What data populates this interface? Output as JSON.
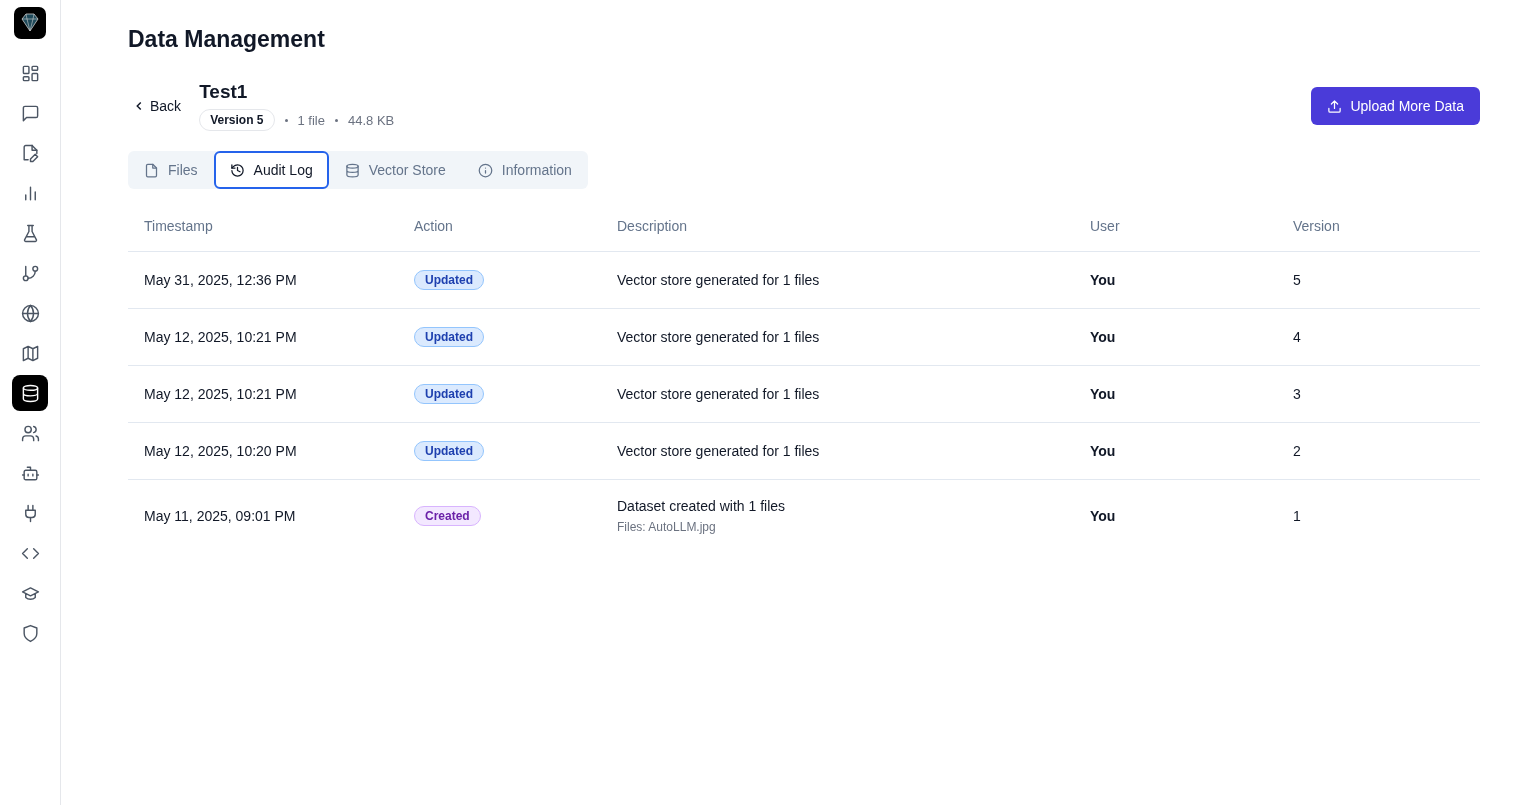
{
  "sidebar": {
    "items": [
      {
        "kind": "grid",
        "selected": false
      },
      {
        "kind": "chat",
        "selected": false
      },
      {
        "kind": "file-edit",
        "selected": false
      },
      {
        "kind": "bars",
        "selected": false
      },
      {
        "kind": "flask",
        "selected": false
      },
      {
        "kind": "branch",
        "selected": false
      },
      {
        "kind": "globe",
        "selected": false
      },
      {
        "kind": "map",
        "selected": false
      },
      {
        "kind": "database",
        "selected": true
      },
      {
        "kind": "users",
        "selected": false
      },
      {
        "kind": "bot",
        "selected": false
      },
      {
        "kind": "plug",
        "selected": false
      },
      {
        "kind": "code",
        "selected": false
      },
      {
        "kind": "cap",
        "selected": false
      },
      {
        "kind": "shield",
        "selected": false
      }
    ]
  },
  "page": {
    "title": "Data Management"
  },
  "dataset": {
    "back": "Back",
    "name": "Test1",
    "version": "Version 5",
    "files": "1 file",
    "size": "44.8 KB",
    "upload_button": "Upload More Data"
  },
  "tabs": [
    {
      "label": "Files",
      "kind": "file",
      "selected": false
    },
    {
      "label": "Audit Log",
      "kind": "history",
      "selected": true
    },
    {
      "label": "Vector Store",
      "kind": "database",
      "selected": false
    },
    {
      "label": "Information",
      "kind": "info",
      "selected": false
    }
  ],
  "table": {
    "columns": [
      "Timestamp",
      "Action",
      "Description",
      "User",
      "Version"
    ],
    "rows": [
      {
        "timestamp": "May 31, 2025, 12:36 PM",
        "action": {
          "label": "Updated",
          "kind": "updated"
        },
        "description": "Vector store generated for 1 files",
        "user": "You",
        "version": "5"
      },
      {
        "timestamp": "May 12, 2025, 10:21 PM",
        "action": {
          "label": "Updated",
          "kind": "updated"
        },
        "description": "Vector store generated for 1 files",
        "user": "You",
        "version": "4"
      },
      {
        "timestamp": "May 12, 2025, 10:21 PM",
        "action": {
          "label": "Updated",
          "kind": "updated"
        },
        "description": "Vector store generated for 1 files",
        "user": "You",
        "version": "3"
      },
      {
        "timestamp": "May 12, 2025, 10:20 PM",
        "action": {
          "label": "Updated",
          "kind": "updated"
        },
        "description": "Vector store generated for 1 files",
        "user": "You",
        "version": "2"
      },
      {
        "timestamp": "May 11, 2025, 09:01 PM",
        "action": {
          "label": "Created",
          "kind": "created"
        },
        "description": "Dataset created with 1 files",
        "note": "Files: AutoLLM.jpg",
        "user": "You",
        "version": "1"
      }
    ]
  }
}
